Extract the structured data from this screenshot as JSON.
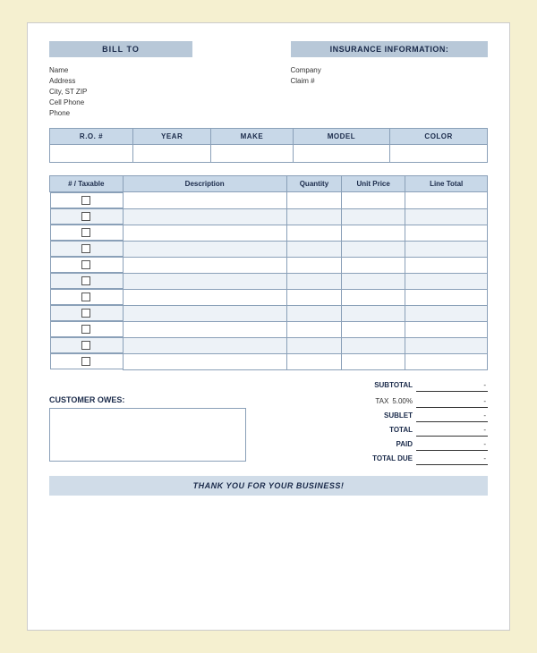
{
  "header": {
    "bill_to_label": "BILL TO",
    "insurance_label": "INSURANCE INFORMATION:"
  },
  "address": {
    "name_label": "Name",
    "address_label": "Address",
    "city_label": "City, ST ZIP",
    "cell_label": "Cell Phone",
    "phone_label": "Phone",
    "company_label": "Company",
    "claim_label": "Claim #"
  },
  "vehicle_table": {
    "headers": [
      "R.O. #",
      "YEAR",
      "MAKE",
      "MODEL",
      "COLOR"
    ]
  },
  "items_table": {
    "headers": [
      "# / Taxable",
      "Description",
      "Quantity",
      "Unit Price",
      "Line Total"
    ],
    "num_rows": 11
  },
  "totals": {
    "subtotal_label": "SUBTOTAL",
    "tax_label": "TAX",
    "tax_percent": "5.00%",
    "sublet_label": "SUBLET",
    "total_label": "TOTAL",
    "paid_label": "PAID",
    "total_due_label": "TOTAL DUE",
    "dash": "-"
  },
  "customer_owes": {
    "label": "CUSTOMER OWES:"
  },
  "footer": {
    "text": "THANK YOU FOR YOUR BUSINESS!"
  }
}
